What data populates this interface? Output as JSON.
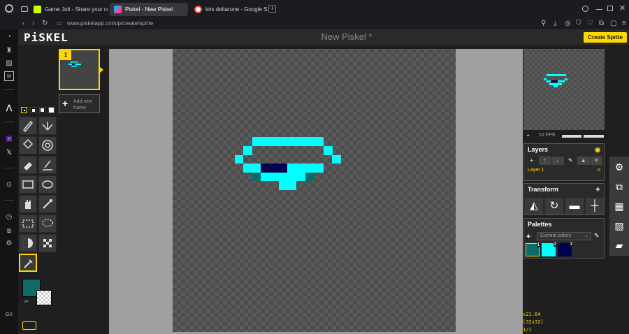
{
  "browser": {
    "tabs": [
      {
        "label": "Game Jolt - Share your cr",
        "favicon_color": "#ccff00"
      },
      {
        "label": "Piskel - New Piskel",
        "favicon_color": "#3aa0ff"
      },
      {
        "label": "kris deltarune - Google Se",
        "favicon_color": "#ea4335"
      }
    ],
    "new_tab_label": "+",
    "address": "www.piskelapp.com/p/create/sprite",
    "sidebar_label": "GX"
  },
  "piskel": {
    "logo": "PiSKEL",
    "title": "New Piskel *",
    "create_button": "Create Sprite",
    "frame_number": "1",
    "add_frame_label": "Add new frame",
    "fps_label": "12 FPS",
    "fps": 12,
    "layers": {
      "title": "Layers",
      "items": [
        "Layer 1"
      ],
      "alpha_symbol": "α"
    },
    "transform": {
      "title": "Transform"
    },
    "palettes": {
      "title": "Palettes",
      "selected": "Current colors",
      "swatches": [
        {
          "index": "1",
          "color": "#0a6b6b"
        },
        {
          "index": "2",
          "color": "#00ffff"
        },
        {
          "index": "3",
          "color": "#000050"
        }
      ]
    },
    "primary_color": "#0a6b6b",
    "secondary_color": "transparent",
    "status": {
      "zoom": "x21.64",
      "size": "[32x32]",
      "frame": "1/1"
    }
  }
}
